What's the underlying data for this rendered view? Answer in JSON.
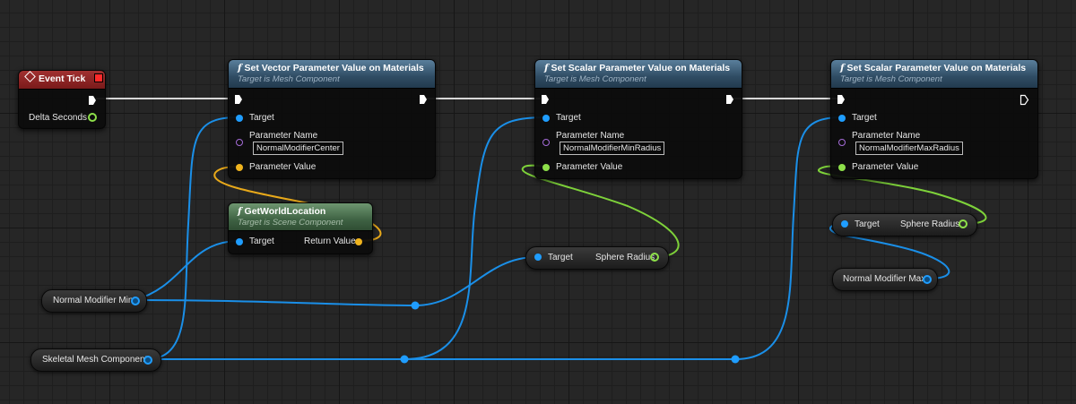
{
  "event_tick": {
    "title": "Event Tick",
    "delta_seconds_label": "Delta Seconds"
  },
  "node_vector": {
    "title": "Set Vector Parameter Value on Materials",
    "subtitle": "Target is Mesh Component",
    "target_label": "Target",
    "param_name_label": "Parameter Name",
    "param_name_value": "NormalModifierCenter",
    "param_value_label": "Parameter Value"
  },
  "node_scalar1": {
    "title": "Set Scalar Parameter Value on Materials",
    "subtitle": "Target is Mesh Component",
    "target_label": "Target",
    "param_name_label": "Parameter Name",
    "param_name_value": "NormalModifierMinRadius",
    "param_value_label": "Parameter Value"
  },
  "node_scalar2": {
    "title": "Set Scalar Parameter Value on Materials",
    "subtitle": "Target is Mesh Component",
    "target_label": "Target",
    "param_name_label": "Parameter Name",
    "param_name_value": "NormalModifierMaxRadius",
    "param_value_label": "Parameter Value"
  },
  "get_world_location": {
    "title": "GetWorldLocation",
    "subtitle": "Target is Scene Component",
    "target_label": "Target",
    "return_label": "Return Value"
  },
  "sphere_radius_1": {
    "target_label": "Target",
    "output_label": "Sphere Radius"
  },
  "sphere_radius_2": {
    "target_label": "Target",
    "output_label": "Sphere Radius"
  },
  "variables": {
    "normal_modifier_min": "Normal Modifier Min",
    "normal_modifier_max": "Normal Modifier Max",
    "skeletal_mesh_component": "Skeletal Mesh Component"
  },
  "colors": {
    "exec": "#ffffff",
    "object_pin": "#1f9dff",
    "vector_pin": "#f0b41e",
    "float_pin": "#8ee04a",
    "name_pin": "#a56cd8",
    "function_header": "#2f4c63",
    "pure_header": "#3f6344",
    "event_header": "#7a1a1a"
  }
}
